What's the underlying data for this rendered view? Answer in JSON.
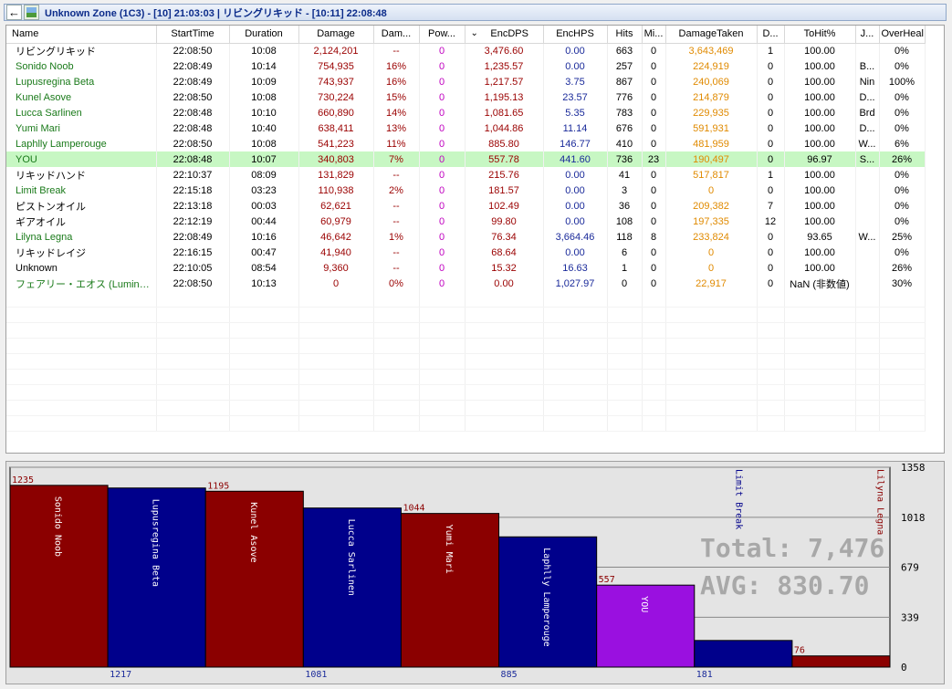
{
  "window": {
    "title": "Unknown Zone (1C3) - [10] 21:03:03  | リビングリキッド - [10:11] 22:08:48",
    "back_icon": "back-arrow-icon",
    "image_icon": "image-icon"
  },
  "table": {
    "columns": [
      "Name",
      "StartTime",
      "Duration",
      "Damage",
      "Dam...",
      "Pow...",
      "EncDPS",
      "EncHPS",
      "Hits",
      "Mi...",
      "DamageTaken",
      "D...",
      "ToHit%",
      "J...",
      "OverHeal..."
    ],
    "sort_icon": "⌄",
    "rows": [
      {
        "name": "リビングリキッド",
        "color": "#000000",
        "start": "22:08:50",
        "dur": "10:08",
        "dmg": "2,124,201",
        "dmgpct": "--",
        "pow": "0",
        "dps": "3,476.60",
        "hps": "0.00",
        "hits": "663",
        "miss": "0",
        "taken": "3,643,469",
        "deaths": "1",
        "tohit": "100.00",
        "job": "",
        "overheal": "0%"
      },
      {
        "name": "Sonido Noob",
        "color": "#1a7a1a",
        "start": "22:08:49",
        "dur": "10:14",
        "dmg": "754,935",
        "dmgpct": "16%",
        "pow": "0",
        "dps": "1,235.57",
        "hps": "0.00",
        "hits": "257",
        "miss": "0",
        "taken": "224,919",
        "deaths": "0",
        "tohit": "100.00",
        "job": "B...",
        "overheal": "0%"
      },
      {
        "name": "Lupusregina Beta",
        "color": "#1a7a1a",
        "start": "22:08:49",
        "dur": "10:09",
        "dmg": "743,937",
        "dmgpct": "16%",
        "pow": "0",
        "dps": "1,217.57",
        "hps": "3.75",
        "hits": "867",
        "miss": "0",
        "taken": "240,069",
        "deaths": "0",
        "tohit": "100.00",
        "job": "Nin",
        "overheal": "100%"
      },
      {
        "name": "Kunel Asove",
        "color": "#1a7a1a",
        "start": "22:08:50",
        "dur": "10:08",
        "dmg": "730,224",
        "dmgpct": "15%",
        "pow": "0",
        "dps": "1,195.13",
        "hps": "23.57",
        "hits": "776",
        "miss": "0",
        "taken": "214,879",
        "deaths": "0",
        "tohit": "100.00",
        "job": "D...",
        "overheal": "0%"
      },
      {
        "name": "Lucca Sarlinen",
        "color": "#1a7a1a",
        "start": "22:08:48",
        "dur": "10:10",
        "dmg": "660,890",
        "dmgpct": "14%",
        "pow": "0",
        "dps": "1,081.65",
        "hps": "5.35",
        "hits": "783",
        "miss": "0",
        "taken": "229,935",
        "deaths": "0",
        "tohit": "100.00",
        "job": "Brd",
        "overheal": "0%"
      },
      {
        "name": "Yumi Mari",
        "color": "#1a7a1a",
        "start": "22:08:48",
        "dur": "10:40",
        "dmg": "638,411",
        "dmgpct": "13%",
        "pow": "0",
        "dps": "1,044.86",
        "hps": "11.14",
        "hits": "676",
        "miss": "0",
        "taken": "591,931",
        "deaths": "0",
        "tohit": "100.00",
        "job": "D...",
        "overheal": "0%"
      },
      {
        "name": "Laphlly Lamperouge",
        "color": "#1a7a1a",
        "start": "22:08:50",
        "dur": "10:08",
        "dmg": "541,223",
        "dmgpct": "11%",
        "pow": "0",
        "dps": "885.80",
        "hps": "146.77",
        "hits": "410",
        "miss": "0",
        "taken": "481,959",
        "deaths": "0",
        "tohit": "100.00",
        "job": "W...",
        "overheal": "6%"
      },
      {
        "name": "YOU",
        "color": "#1a7a1a",
        "start": "22:08:48",
        "dur": "10:07",
        "dmg": "340,803",
        "dmgpct": "7%",
        "pow": "0",
        "dps": "557.78",
        "hps": "441.60",
        "hits": "736",
        "miss": "23",
        "taken": "190,497",
        "deaths": "0",
        "tohit": "96.97",
        "job": "S...",
        "overheal": "26%",
        "selected": true
      },
      {
        "name": "リキッドハンド",
        "color": "#000000",
        "start": "22:10:37",
        "dur": "08:09",
        "dmg": "131,829",
        "dmgpct": "--",
        "pow": "0",
        "dps": "215.76",
        "hps": "0.00",
        "hits": "41",
        "miss": "0",
        "taken": "517,817",
        "deaths": "1",
        "tohit": "100.00",
        "job": "",
        "overheal": "0%"
      },
      {
        "name": "Limit Break",
        "color": "#1a7a1a",
        "start": "22:15:18",
        "dur": "03:23",
        "dmg": "110,938",
        "dmgpct": "2%",
        "pow": "0",
        "dps": "181.57",
        "hps": "0.00",
        "hits": "3",
        "miss": "0",
        "taken": "0",
        "deaths": "0",
        "tohit": "100.00",
        "job": "",
        "overheal": "0%"
      },
      {
        "name": "ピストンオイル",
        "color": "#000000",
        "start": "22:13:18",
        "dur": "00:03",
        "dmg": "62,621",
        "dmgpct": "--",
        "pow": "0",
        "dps": "102.49",
        "hps": "0.00",
        "hits": "36",
        "miss": "0",
        "taken": "209,382",
        "deaths": "7",
        "tohit": "100.00",
        "job": "",
        "overheal": "0%"
      },
      {
        "name": "ギアオイル",
        "color": "#000000",
        "start": "22:12:19",
        "dur": "00:44",
        "dmg": "60,979",
        "dmgpct": "--",
        "pow": "0",
        "dps": "99.80",
        "hps": "0.00",
        "hits": "108",
        "miss": "0",
        "taken": "197,335",
        "deaths": "12",
        "tohit": "100.00",
        "job": "",
        "overheal": "0%"
      },
      {
        "name": "Lilyna Legna",
        "color": "#1a7a1a",
        "start": "22:08:49",
        "dur": "10:16",
        "dmg": "46,642",
        "dmgpct": "1%",
        "pow": "0",
        "dps": "76.34",
        "hps": "3,664.46",
        "hits": "118",
        "miss": "8",
        "taken": "233,824",
        "deaths": "0",
        "tohit": "93.65",
        "job": "W...",
        "overheal": "25%"
      },
      {
        "name": "リキッドレイジ",
        "color": "#000000",
        "start": "22:16:15",
        "dur": "00:47",
        "dmg": "41,940",
        "dmgpct": "--",
        "pow": "0",
        "dps": "68.64",
        "hps": "0.00",
        "hits": "6",
        "miss": "0",
        "taken": "0",
        "deaths": "0",
        "tohit": "100.00",
        "job": "",
        "overheal": "0%"
      },
      {
        "name": "Unknown",
        "color": "#000000",
        "start": "22:10:05",
        "dur": "08:54",
        "dmg": "9,360",
        "dmgpct": "--",
        "pow": "0",
        "dps": "15.32",
        "hps": "16.63",
        "hits": "1",
        "miss": "0",
        "taken": "0",
        "deaths": "0",
        "tohit": "100.00",
        "job": "",
        "overheal": "26%"
      },
      {
        "name": "フェアリー・エオス (Lumina ...",
        "color": "#1a7a1a",
        "start": "22:08:50",
        "dur": "10:13",
        "dmg": "0",
        "dmgpct": "0%",
        "pow": "0",
        "dps": "0.00",
        "hps": "1,027.97",
        "hits": "0",
        "miss": "0",
        "taken": "22,917",
        "deaths": "0",
        "tohit": "NaN (非数値)",
        "job": "",
        "overheal": "30%"
      }
    ]
  },
  "chart_data": {
    "type": "bar",
    "categories": [
      "Sonido Noob",
      "Lupusregina Beta",
      "Kunel Asove",
      "Lucca Sarlinen",
      "Yumi Mari",
      "Laphlly Lamperouge",
      "YOU",
      "Limit Break",
      "Lilyna Legna"
    ],
    "values": [
      1235,
      1217,
      1195,
      1081,
      1044,
      885,
      557,
      181,
      76
    ],
    "value_labels": [
      "1235",
      "1217",
      "1195",
      "1081",
      "1044",
      "885",
      "557",
      "181",
      "76"
    ],
    "bar_colors": [
      "#8b0000",
      "#00008b",
      "#8b0000",
      "#00008b",
      "#8b0000",
      "#00008b",
      "#9a10e0",
      "#00008b",
      "#8b0000"
    ],
    "ylim": [
      0,
      1358
    ],
    "yticks": [
      "0",
      "339",
      "679",
      "1018",
      "1358"
    ],
    "total_text": "Total: 7,476",
    "avg_text": "AVG: 830.70"
  }
}
